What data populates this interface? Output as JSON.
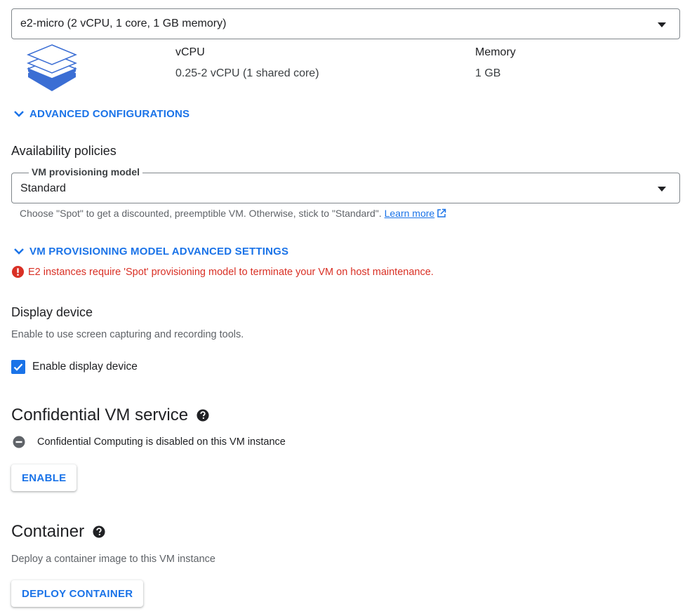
{
  "machine_select": {
    "value": "e2-micro (2 vCPU, 1 core, 1 GB memory)"
  },
  "specs": {
    "vcpu_header": "vCPU",
    "vcpu_value": "0.25-2 vCPU (1 shared core)",
    "memory_header": "Memory",
    "memory_value": "1 GB"
  },
  "advanced_configurations": {
    "label": "ADVANCED CONFIGURATIONS"
  },
  "availability": {
    "title": "Availability policies",
    "provisioning_label": "VM provisioning model",
    "provisioning_value": "Standard",
    "helper_text": "Choose \"Spot\" to get a discounted, preemptible VM. Otherwise, stick to \"Standard\".",
    "learn_more": "Learn more",
    "advanced_settings_label": "VM PROVISIONING MODEL ADVANCED SETTINGS",
    "error_text": "E2 instances require 'Spot' provisioning model to terminate your VM on host maintenance."
  },
  "display_device": {
    "title": "Display device",
    "description": "Enable to use screen capturing and recording tools.",
    "checkbox_label": "Enable display device",
    "checked": true
  },
  "confidential": {
    "title": "Confidential VM service",
    "status_text": "Confidential Computing is disabled on this VM instance",
    "button_label": "ENABLE"
  },
  "container": {
    "title": "Container",
    "description": "Deploy a container image to this VM instance",
    "button_label": "DEPLOY CONTAINER"
  },
  "colors": {
    "accent": "#1a73e8",
    "error": "#d93025",
    "text": "#202124",
    "muted": "#5f6368"
  },
  "icons": {
    "machine": "layers-stack-icon",
    "expand": "chevron-down-icon",
    "external": "open-in-new-icon",
    "error": "error-icon",
    "check": "check-icon",
    "help": "help-icon",
    "disabled": "remove-circle-icon"
  }
}
